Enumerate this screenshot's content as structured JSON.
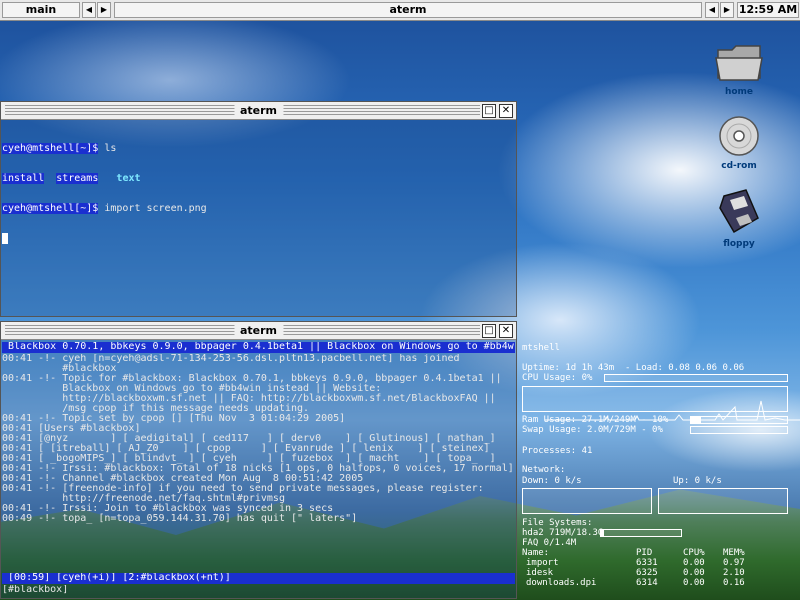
{
  "toolbar": {
    "workspace": "main",
    "window_title": "aterm",
    "clock": "12:59 AM"
  },
  "desktop_icons": [
    {
      "label": "home",
      "icon": "folder-icon"
    },
    {
      "label": "cd-rom",
      "icon": "cdrom-icon"
    },
    {
      "label": "floppy",
      "icon": "floppy-icon"
    }
  ],
  "term1": {
    "title": "aterm",
    "line1_prompt": "cyeh@mtshell[~]$",
    "line1_cmd": " ls",
    "line2_a": "install",
    "line2_b": "streams",
    "line2_c": "text",
    "line3_prompt": "cyeh@mtshell[~]$",
    "line3_cmd": " import screen.png"
  },
  "term2": {
    "title": "aterm",
    "topic_bar": " Blackbox 0.70.1, bbkeys 0.9.0, bbpager 0.4.1beta1 || Blackbox on Windows go to #bb4w",
    "lines": [
      "00:41 -!- cyeh [n=cyeh@adsl-71-134-253-56.dsl.pltn13.pacbell.net] has joined",
      "          #blackbox",
      "00:41 -!- Topic for #blackbox: Blackbox 0.70.1, bbkeys 0.9.0, bbpager 0.4.1beta1 ||",
      "          Blackbox on Windows go to #bb4win instead || Website:",
      "          http://blackboxwm.sf.net || FAQ: http://blackboxwm.sf.net/BlackboxFAQ ||",
      "          /msg cpop if this message needs updating.",
      "00:41 -!- Topic set by cpop [] [Thu Nov  3 01:04:29 2005]",
      "00:41 [Users #blackbox]",
      "00:41 [@nyz       ] [ aedigital] [ ced117   ] [ derv0    ] [ Glutinous] [ nathan_]",
      "00:41 [ [itreball] [ AJ_Z0    ] [ cpop     ] [ Evanrude ] [ lenix    ] [ steinex]",
      "00:41 [ _bogoMIPS_] [ blindvt_ ] [ cyeh     ] [ fuzebox  ] [ macht    ] [ topa_  ]",
      "00:41 -!- Irssi: #blackbox: Total of 18 nicks [1 ops, 0 halfops, 0 voices, 17 normal]",
      "00:41 -!- Channel #blackbox created Mon Aug  8 00:51:42 2005",
      "00:41 -!- [freenode-info] if you need to send private messages, please register:",
      "          http://freenode.net/faq.shtml#privmsg",
      "00:41 -!- Irssi: Join to #blackbox was synced in 3 secs",
      "00:49 -!- topa_ [n=topa_059.144.31.70] has quit [\" laters\"]"
    ],
    "status_bar": " [00:59] [cyeh(+i)] [2:#blackbox(+nt)]",
    "input_line": "[#blackbox] "
  },
  "conky": {
    "hostname": "mtshell",
    "uptime": "Uptime: 1d 1h 43m  - Load: 0.08 0.06 0.06",
    "cpu_label": "CPU Usage: 0%",
    "cpu_usage": 0,
    "ram_label": "Ram Usage: 27.1M/249M - 10%",
    "ram_usage": 10,
    "swap_label": "Swap Usage: 2.0M/729M - 0%",
    "swap_usage": 0,
    "processes": "Processes: 41",
    "network_label": "Network:",
    "down_label": "Down: 0 k/s",
    "up_label": "Up: 0 k/s",
    "fs_label": "File Systems:",
    "fs_line": "hda2 719M/18.3G",
    "fs_usage": 4,
    "fs_line2": "FAQ 0/1.4M",
    "table_header": [
      "Name:",
      "PID",
      "CPU%",
      "MEM%"
    ],
    "processes_list": [
      [
        "import",
        "6331",
        "0.00",
        "0.97"
      ],
      [
        "idesk",
        "6325",
        "0.00",
        "2.10"
      ],
      [
        "downloads.dpi",
        "6314",
        "0.00",
        "0.16"
      ]
    ]
  }
}
